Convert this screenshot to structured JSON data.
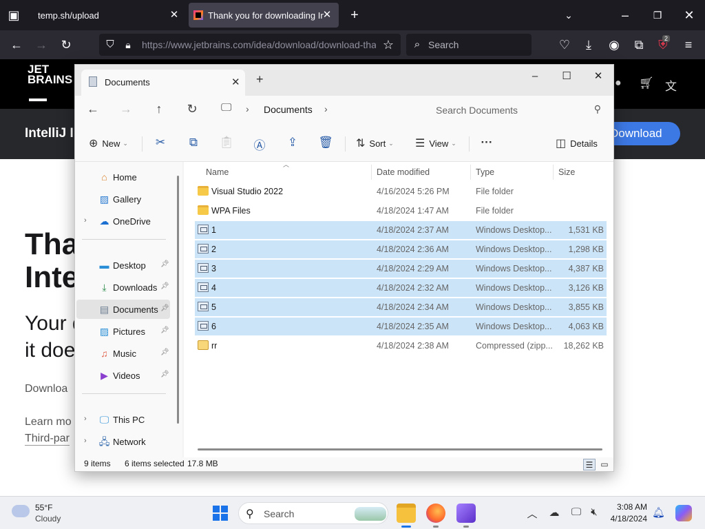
{
  "browser": {
    "tabs": [
      {
        "title": "temp.sh/upload"
      },
      {
        "title": "Thank you for downloading IntelliJ"
      }
    ],
    "url": "https://www.jetbrains.com/idea/download/download-thanks",
    "search_placeholder": "Search",
    "extension_badge": "2"
  },
  "webpage": {
    "logo_line1": "JET",
    "logo_line2": "BRAINS",
    "product": "IntelliJ I",
    "download_button": "Download",
    "heading_1": "Tha",
    "heading_2": "Inte",
    "sub_1": "Your d",
    "sub_2": "it doe",
    "line_download": "Downloa",
    "line_learn": "Learn mo",
    "line_third": "Third-par"
  },
  "explorer": {
    "tab_title": "Documents",
    "breadcrumb": "Documents",
    "search_placeholder": "Search Documents",
    "commands": {
      "new": "New",
      "sort": "Sort",
      "view": "View",
      "details": "Details"
    },
    "nav": {
      "home": "Home",
      "gallery": "Gallery",
      "onedrive": "OneDrive",
      "desktop": "Desktop",
      "downloads": "Downloads",
      "documents": "Documents",
      "pictures": "Pictures",
      "music": "Music",
      "videos": "Videos",
      "thispc": "This PC",
      "network": "Network"
    },
    "columns": {
      "name": "Name",
      "date": "Date modified",
      "type": "Type",
      "size": "Size"
    },
    "files": [
      {
        "name": "Visual Studio 2022",
        "date": "4/16/2024 5:26 PM",
        "type": "File folder",
        "size": "",
        "kind": "folder",
        "selected": false
      },
      {
        "name": "WPA Files",
        "date": "4/18/2024 1:47 AM",
        "type": "File folder",
        "size": "",
        "kind": "folder",
        "selected": false
      },
      {
        "name": "1",
        "date": "4/18/2024 2:37 AM",
        "type": "Windows Desktop...",
        "size": "1,531 KB",
        "kind": "rdp",
        "selected": true
      },
      {
        "name": "2",
        "date": "4/18/2024 2:36 AM",
        "type": "Windows Desktop...",
        "size": "1,298 KB",
        "kind": "rdp",
        "selected": true
      },
      {
        "name": "3",
        "date": "4/18/2024 2:29 AM",
        "type": "Windows Desktop...",
        "size": "4,387 KB",
        "kind": "rdp",
        "selected": true
      },
      {
        "name": "4",
        "date": "4/18/2024 2:32 AM",
        "type": "Windows Desktop...",
        "size": "3,126 KB",
        "kind": "rdp",
        "selected": true
      },
      {
        "name": "5",
        "date": "4/18/2024 2:34 AM",
        "type": "Windows Desktop...",
        "size": "3,855 KB",
        "kind": "rdp",
        "selected": true
      },
      {
        "name": "6",
        "date": "4/18/2024 2:35 AM",
        "type": "Windows Desktop...",
        "size": "4,063 KB",
        "kind": "rdp",
        "selected": true
      },
      {
        "name": "rr",
        "date": "4/18/2024 2:38 AM",
        "type": "Compressed (zipp...",
        "size": "18,262 KB",
        "kind": "zip",
        "selected": false
      }
    ],
    "status": {
      "count": "9 items",
      "selected": "6 items selected",
      "size": "17.8 MB"
    }
  },
  "taskbar": {
    "weather_temp": "55°F",
    "weather_desc": "Cloudy",
    "search_label": "Search",
    "time": "3:08 AM",
    "date": "4/18/2024"
  }
}
